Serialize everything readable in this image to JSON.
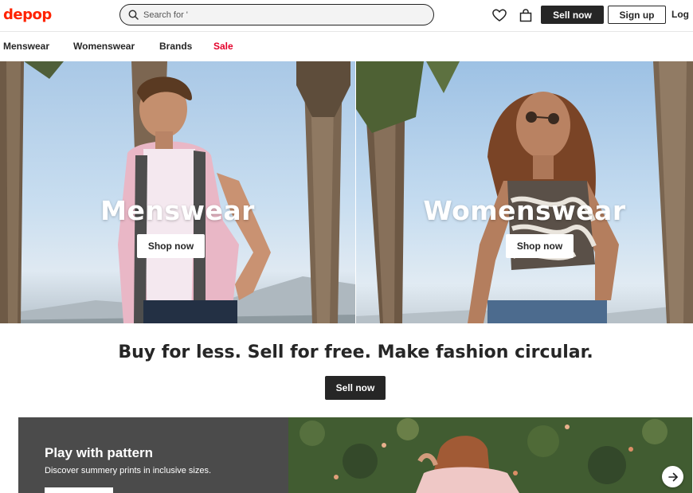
{
  "header": {
    "logo": "depop",
    "search_placeholder": "Search for '",
    "sell_label": "Sell now",
    "signup_label": "Sign up",
    "login_label": "Log"
  },
  "nav": {
    "items": [
      "Menswear",
      "Womenswear",
      "Brands",
      "Sale"
    ],
    "sale_color": "#e4002b"
  },
  "heroes": [
    {
      "title": "Menswear",
      "button": "Shop now"
    },
    {
      "title": "Womenswear",
      "button": "Shop now"
    }
  ],
  "tagline": "Buy for less. Sell for free. Make fashion circular.",
  "cta_label": "Sell now",
  "promo": {
    "title": "Play with pattern",
    "subtitle": "Discover summery prints in inclusive sizes."
  },
  "colors": {
    "brand": "#ff2300",
    "dark": "#262626",
    "promo_bg": "#4b4b4b"
  },
  "icons": [
    "search-icon",
    "heart-icon",
    "bag-icon",
    "arrow-right-icon"
  ]
}
